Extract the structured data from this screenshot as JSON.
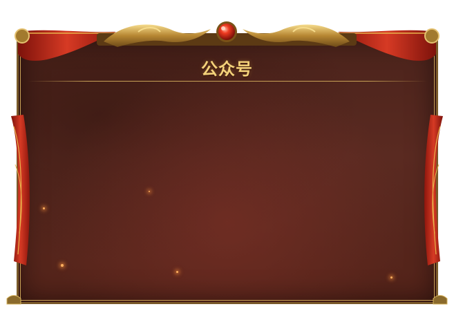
{
  "dialog": {
    "title": "公众号"
  },
  "colors": {
    "panel_background": "#4b231b",
    "title_gold": "#f4d27a",
    "frame_gold": "#c9a257",
    "curtain_red": "#c0281c",
    "jewel_red": "#e0301c"
  },
  "decorations": {
    "crest": "golden-dragon-crest-icon",
    "jewel": "red-jewel-icon",
    "left_curtain": "red-curtain-left",
    "right_curtain": "red-curtain-right"
  }
}
